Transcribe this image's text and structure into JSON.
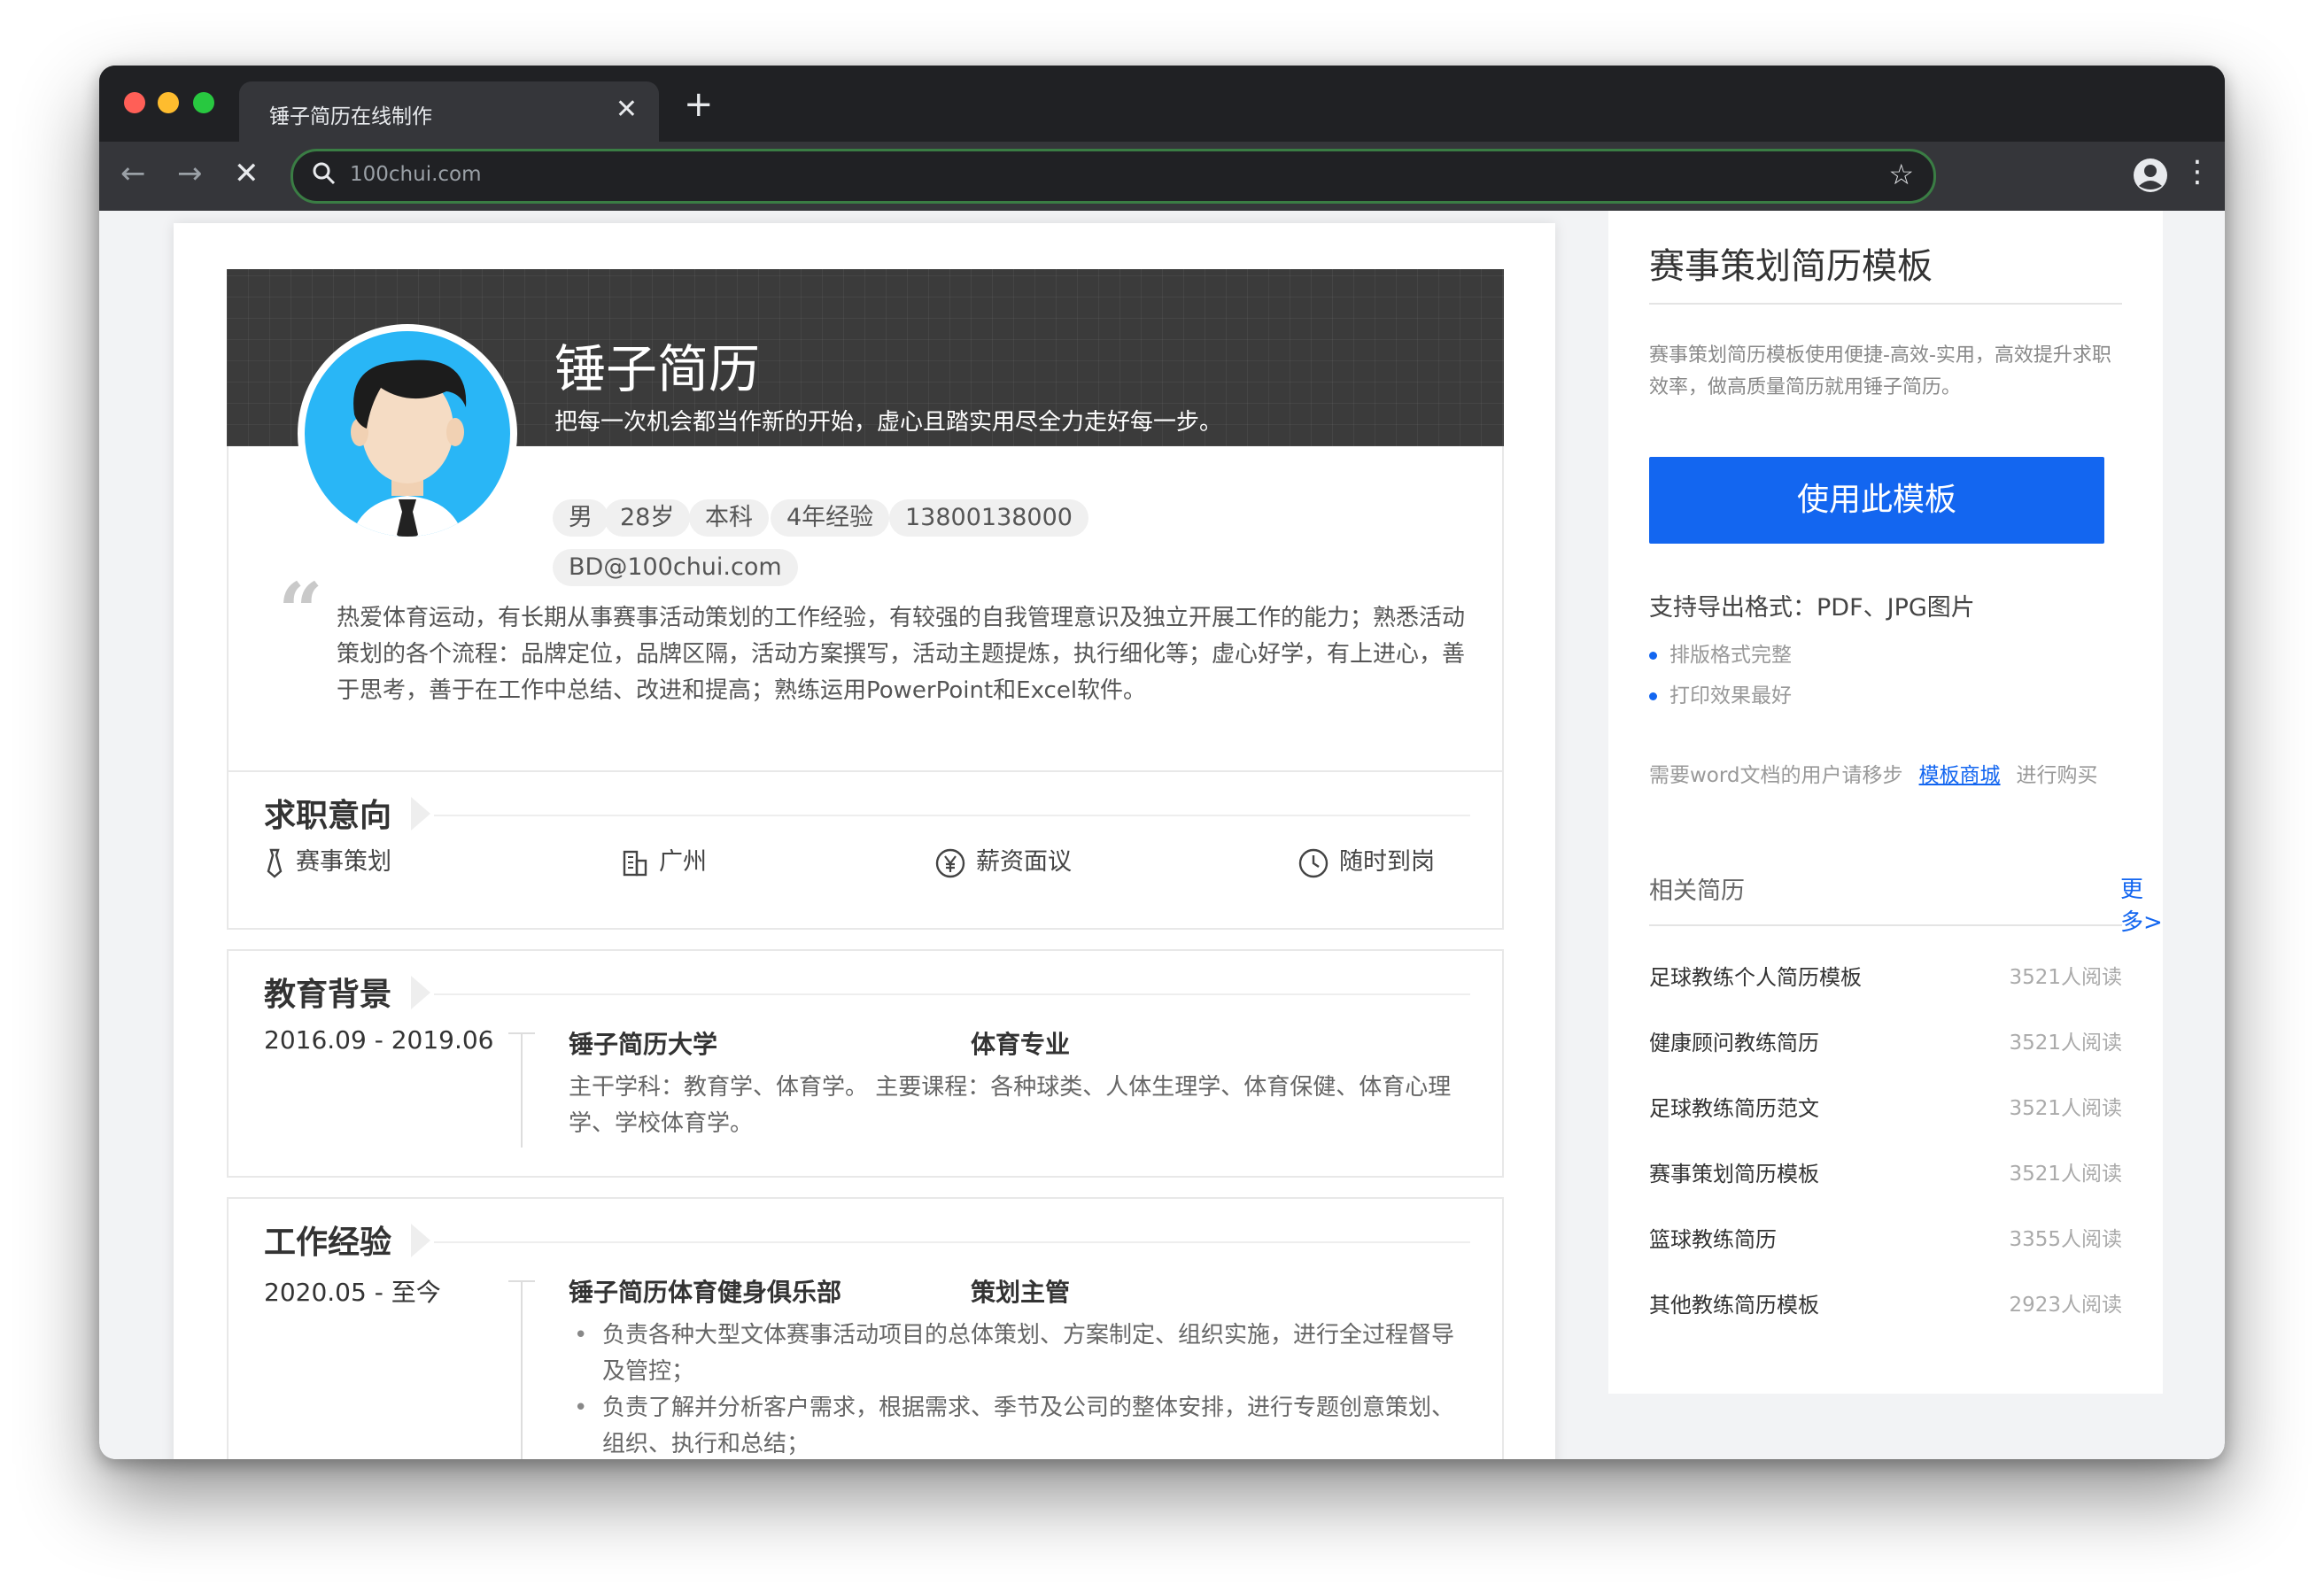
{
  "browser": {
    "tab_title": "锤子简历在线制作",
    "tab_close": "✕",
    "new_tab": "+",
    "url": "100chui.com",
    "back": "←",
    "forward": "→",
    "stop": "✕",
    "star": "☆",
    "menu": "⋮"
  },
  "resume": {
    "name": "锤子简历",
    "motto": "把每一次机会都当作新的开始，虚心且踏实用尽全力走好每一步。",
    "tags": [
      "男",
      "28岁",
      "本科",
      "4年经验",
      "13800138000",
      "BD@100chui.com"
    ],
    "summary": "热爱体育运动，有长期从事赛事活动策划的工作经验，有较强的自我管理意识及独立开展工作的能力；熟悉活动策划的各个流程：品牌定位，品牌区隔，活动方案撰写，活动主题提炼，执行细化等；虚心好学，有上进心，善于思考，善于在工作中总结、改进和提高；熟练运用PowerPoint和Excel软件。",
    "intent": {
      "title": "求职意向",
      "position": "赛事策划",
      "city": "广州",
      "salary": "薪资面议",
      "availability": "随时到岗"
    },
    "education": {
      "title": "教育背景",
      "dates": "2016.09 - 2019.06",
      "school": "锤子简历大学",
      "major": "体育专业",
      "desc": "主干学科：教育学、体育学。 主要课程：各种球类、人体生理学、体育保健、体育心理学、学校体育学。"
    },
    "work": {
      "title": "工作经验",
      "dates": "2020.05 - 至今",
      "company": "锤子简历体育健身俱乐部",
      "role": "策划主管",
      "bullets": [
        "负责各种大型文体赛事活动项目的总体策划、方案制定、组织实施，进行全过程督导及管控；",
        "负责了解并分析客户需求，根据需求、季节及公司的整体安排，进行专题创意策划、组织、执行和总结；"
      ]
    }
  },
  "sidebar": {
    "title": "赛事策划简历模板",
    "desc": "赛事策划简历模板使用便捷-高效-实用，高效提升求职效率，做高质量简历就用锤子简历。",
    "use_button": "使用此模板",
    "export_label": "支持导出格式：PDF、JPG图片",
    "features": [
      "排版格式完整",
      "打印效果最好"
    ],
    "word_note_pre": "需要word文档的用户请移步",
    "word_note_link": "模板商城",
    "word_note_post": "进行购买",
    "related_title": "相关简历",
    "more": "更多>",
    "related": [
      {
        "name": "足球教练个人简历模板",
        "reads": "3521人阅读"
      },
      {
        "name": "健康顾问教练简历",
        "reads": "3521人阅读"
      },
      {
        "name": "足球教练简历范文",
        "reads": "3521人阅读"
      },
      {
        "name": "赛事策划简历模板",
        "reads": "3521人阅读"
      },
      {
        "name": "篮球教练简历",
        "reads": "3355人阅读"
      },
      {
        "name": "其他教练简历模板",
        "reads": "2923人阅读"
      }
    ]
  },
  "colors": {
    "accent": "#1366f0",
    "header_bg": "#3b3b3b",
    "avatar_ring": "#29b6f6"
  }
}
